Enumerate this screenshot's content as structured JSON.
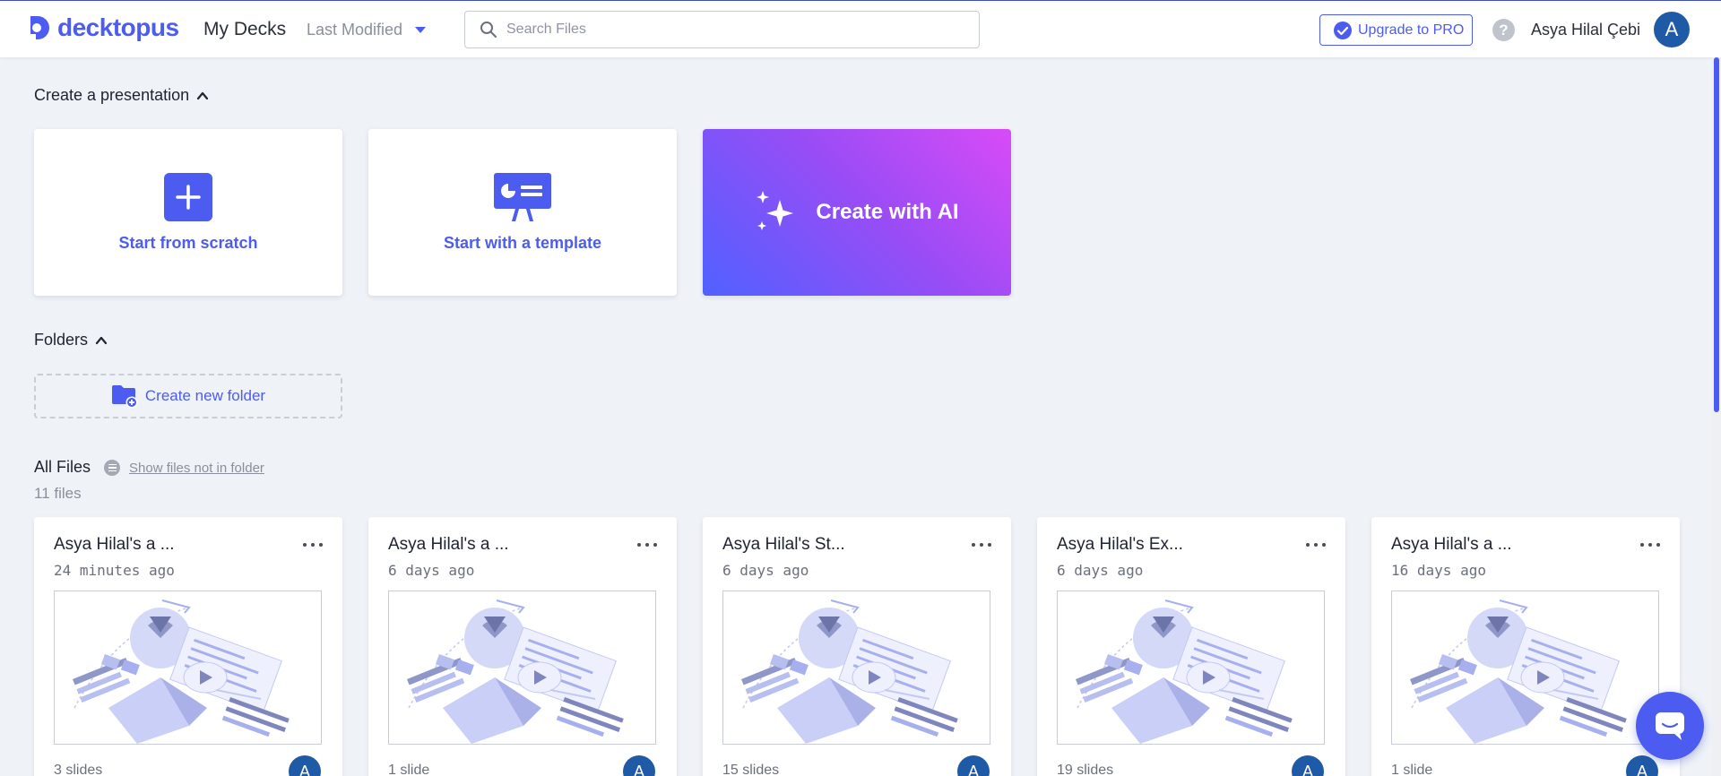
{
  "header": {
    "brand": "decktopus",
    "section_title": "My Decks",
    "sort_label": "Last Modified",
    "search_placeholder": "Search Files",
    "upgrade_label": "Upgrade to PRO",
    "help_glyph": "?",
    "user_name": "Asya Hilal Çebi",
    "user_initial": "A"
  },
  "create": {
    "title": "Create a presentation",
    "scratch_label": "Start from scratch",
    "template_label": "Start with a template",
    "ai_label": "Create with AI"
  },
  "folders": {
    "title": "Folders",
    "new_folder_label": "Create new folder"
  },
  "files": {
    "title": "All Files",
    "filter_label": "Show files not in folder",
    "count_label": "11 files",
    "items": [
      {
        "title": "Asya Hilal's a ...",
        "modified": "24 minutes ago",
        "slides": "3 slides",
        "owner_initial": "A"
      },
      {
        "title": "Asya Hilal's a ...",
        "modified": "6 days ago",
        "slides": "1 slide",
        "owner_initial": "A"
      },
      {
        "title": "Asya Hilal's St...",
        "modified": "6 days ago",
        "slides": "15 slides",
        "owner_initial": "A"
      },
      {
        "title": "Asya Hilal's Ex...",
        "modified": "6 days ago",
        "slides": "19 slides",
        "owner_initial": "A"
      },
      {
        "title": "Asya Hilal's a ...",
        "modified": "16 days ago",
        "slides": "1 slide",
        "owner_initial": "A"
      }
    ]
  },
  "colors": {
    "accent": "#4c5cf0",
    "avatar": "#1f5aa6",
    "background": "#eff2f7",
    "ai_gradient_start": "#5061ff",
    "ai_gradient_end": "#d84bf7"
  },
  "icons": {
    "logo": "decktopus-logo-icon",
    "sort": "caret-down-icon",
    "search": "search-icon",
    "upgrade": "verified-badge-icon",
    "help": "help-icon",
    "collapse": "chevron-up-icon",
    "scratch": "plus-icon",
    "template": "presentation-board-icon",
    "ai": "sparkles-icon",
    "new_folder": "folder-add-icon",
    "filter": "list-icon",
    "file_menu": "more-horizontal-icon",
    "chat": "chat-icon"
  }
}
